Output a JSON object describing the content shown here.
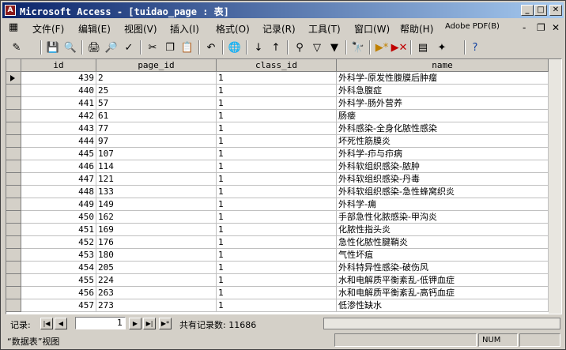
{
  "window": {
    "title": "Microsoft Access - [tuidao_page : 表]",
    "icon_label": "A"
  },
  "title_buttons": {
    "minimize": "_",
    "maximize": "□",
    "close": "✕"
  },
  "menu": [
    "文件(F)",
    "编辑(E)",
    "视图(V)",
    "插入(I)",
    "格式(O)",
    "记录(R)",
    "工具(T)",
    "窗口(W)",
    "帮助(H)",
    "Adobe PDF(B)"
  ],
  "mdi_buttons": {
    "minimize": "-",
    "restore": "❐",
    "close": "✕"
  },
  "toolbar_icons": [
    "design-view-icon",
    "save-icon",
    "search-icon",
    "print-icon",
    "print-preview-icon",
    "spelling-icon",
    "cut-icon",
    "copy-icon",
    "paste-icon",
    "undo-icon",
    "hyperlink-icon",
    "sort-ascending-icon",
    "sort-descending-icon",
    "filter-by-selection-icon",
    "filter-by-form-icon",
    "apply-filter-icon",
    "find-icon",
    "new-record-icon",
    "delete-record-icon",
    "database-window-icon",
    "new-object-icon",
    "help-icon"
  ],
  "table": {
    "columns": [
      "id",
      "page_id",
      "class_id",
      "name"
    ],
    "rows": [
      [
        439,
        2,
        1,
        "外科学-原发性腹膜后肿瘤"
      ],
      [
        440,
        25,
        1,
        "外科急腹症"
      ],
      [
        441,
        57,
        1,
        "外科学-肠外营养"
      ],
      [
        442,
        61,
        1,
        "肠瘘"
      ],
      [
        443,
        77,
        1,
        "外科感染-全身化脓性感染"
      ],
      [
        444,
        97,
        1,
        "坏死性筋膜炎"
      ],
      [
        445,
        107,
        1,
        "外科学-疖与疖病"
      ],
      [
        446,
        114,
        1,
        "外科软组织感染-脓肿"
      ],
      [
        447,
        121,
        1,
        "外科软组织感染-丹毒"
      ],
      [
        448,
        133,
        1,
        "外科软组织感染-急性蜂窝织炎"
      ],
      [
        449,
        149,
        1,
        "外科学-痈"
      ],
      [
        450,
        162,
        1,
        "手部急性化脓感染-甲沟炎"
      ],
      [
        451,
        169,
        1,
        "化脓性指头炎"
      ],
      [
        452,
        176,
        1,
        "急性化脓性腱鞘炎"
      ],
      [
        453,
        180,
        1,
        "气性坏疽"
      ],
      [
        454,
        205,
        1,
        "外科特异性感染-破伤风"
      ],
      [
        455,
        224,
        1,
        "水和电解质平衡紊乱-低钾血症"
      ],
      [
        456,
        263,
        1,
        "水和电解质平衡紊乱-高钙血症"
      ],
      [
        457,
        273,
        1,
        "低渗性缺水"
      ]
    ]
  },
  "navigation": {
    "label": "记录:",
    "current": "1",
    "count_text": "共有记录数: 11686",
    "first": "|◀",
    "prev": "◀",
    "next": "▶",
    "last": "▶|",
    "new": "▶*"
  },
  "status": {
    "text": "“数据表”视图",
    "num": "NUM"
  }
}
